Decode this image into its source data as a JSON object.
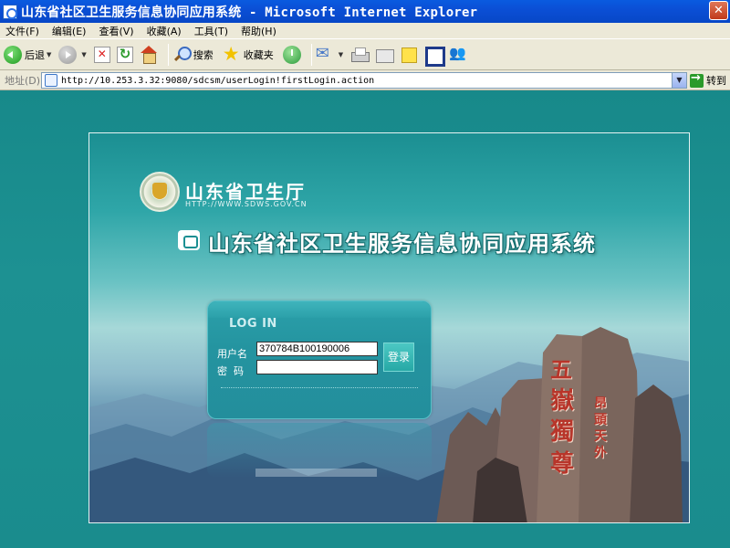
{
  "window": {
    "title": "山东省社区卫生服务信息协同应用系统 - Microsoft Internet Explorer",
    "close_label": "✕"
  },
  "menu": {
    "items": [
      "文件(F)",
      "编辑(E)",
      "查看(V)",
      "收藏(A)",
      "工具(T)",
      "帮助(H)"
    ]
  },
  "toolbar": {
    "back_label": "后退",
    "search_label": "搜索",
    "favorites_label": "收藏夹"
  },
  "address": {
    "label": "地址(D)",
    "url": "http://10.253.3.32:9080/sdcsm/userLogin!firstLogin.action",
    "go_label": "转到"
  },
  "page": {
    "org_name": "山东省卫生厅",
    "org_url": "HTTP://WWW.SDWS.GOV.CN",
    "system_title": "山东省社区卫生服务信息协同应用系统",
    "login": {
      "title": "LOG IN",
      "username_label": "用户名",
      "password_label": "密码",
      "username_value": "370784B100190006",
      "password_value": "",
      "submit_label": "登录"
    },
    "rock_inscriptions": {
      "main": [
        "五",
        "嶽",
        "獨",
        "尊"
      ],
      "side": [
        "昂",
        "頭",
        "天",
        "外"
      ]
    }
  },
  "colors": {
    "titlebar": "#0a5be0",
    "content_bg": "#1a8a8a",
    "login_box": "#2494a0",
    "rock_text": "#b8352a"
  }
}
